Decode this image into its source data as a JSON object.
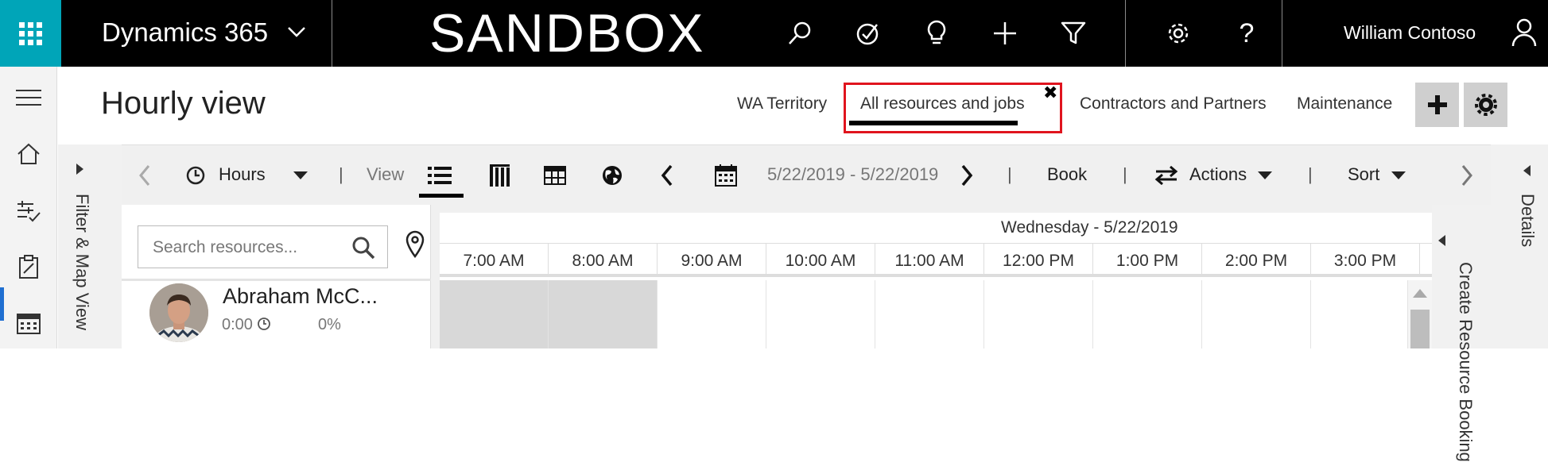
{
  "topbar": {
    "waffle_icon": "waffle-icon",
    "app_name": "Dynamics 365",
    "environment": "SANDBOX",
    "icons": [
      "search-icon",
      "task-icon",
      "lightbulb-icon",
      "plus-icon",
      "filter-icon",
      "gear-icon",
      "help-icon"
    ],
    "user_name": "William Contoso",
    "colors": {
      "bar": "#000000",
      "waffle": "#00a5b8"
    }
  },
  "leftnav": {
    "items": [
      "hamburger-icon",
      "home-icon",
      "planning-icon",
      "clipboard-icon",
      "calendar-icon"
    ],
    "active_color": "#1f6fd1"
  },
  "header": {
    "title": "Hourly view",
    "tabs": [
      {
        "label": "WA Territory"
      },
      {
        "label": "All resources and jobs",
        "active": true
      },
      {
        "label": "Contractors and Partners"
      },
      {
        "label": "Maintenance"
      }
    ],
    "close_glyph": "✖",
    "highlight_color": "#e0141e"
  },
  "filter_panel": {
    "label": "Filter & Map View"
  },
  "details_panel": {
    "label": "Details"
  },
  "toolbar": {
    "hours_label": "Hours",
    "view_label": "View",
    "date_range": "5/22/2019 - 5/22/2019",
    "book_label": "Book",
    "actions_label": "Actions",
    "sort_label": "Sort"
  },
  "resources": {
    "search_placeholder": "Search resources...",
    "items": [
      {
        "name": "Abraham McC...",
        "hours": "0:00",
        "utilization": "0%"
      }
    ]
  },
  "schedule": {
    "day_label": "Wednesday - 5/22/2019",
    "times": [
      "7:00 AM",
      "8:00 AM",
      "9:00 AM",
      "10:00 AM",
      "11:00 AM",
      "12:00 PM",
      "1:00 PM",
      "2:00 PM",
      "3:00 PM"
    ]
  },
  "create_panel": {
    "label": "Create Resource Booking"
  }
}
